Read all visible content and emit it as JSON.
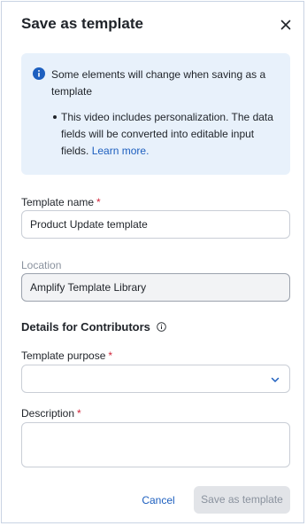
{
  "dialog": {
    "title": "Save as template",
    "close_icon": "close-icon"
  },
  "notice": {
    "icon": "info-icon",
    "heading": "Some elements will change when saving as a template",
    "bullet_text": "This video includes personalization. The data fields will be converted into editable input fields.",
    "link_text": "Learn more."
  },
  "fields": {
    "template_name": {
      "label": "Template name",
      "required_mark": "*",
      "value": "Product Update template"
    },
    "location": {
      "label": "Location",
      "value": "Amplify Template Library"
    },
    "contributors_section": {
      "title": "Details for Contributors",
      "icon": "info-icon"
    },
    "template_purpose": {
      "label": "Template purpose",
      "required_mark": "*",
      "value": "",
      "icon": "chevron-down-icon"
    },
    "description": {
      "label": "Description",
      "required_mark": "*",
      "value": ""
    }
  },
  "footer": {
    "cancel_label": "Cancel",
    "save_label": "Save as template"
  },
  "colors": {
    "accent": "#1d5fbf",
    "required": "#d0253a",
    "notice_bg": "#e8f1fb",
    "disabled_button_bg": "#e2e4e8"
  }
}
